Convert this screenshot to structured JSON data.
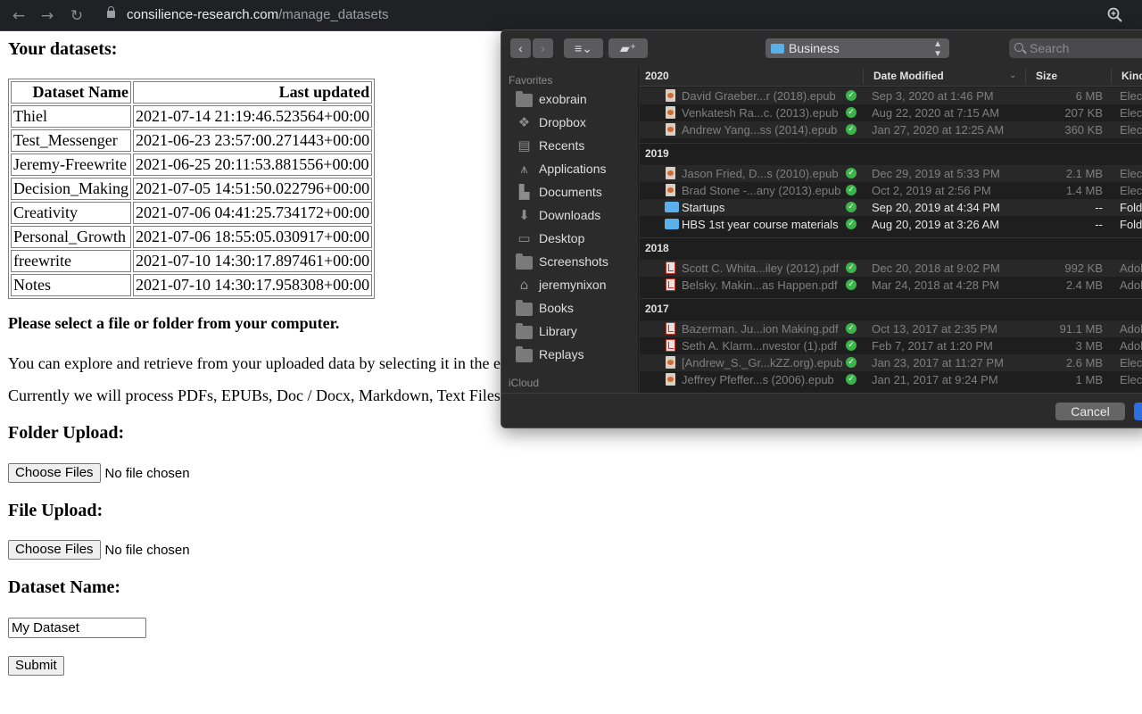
{
  "browser": {
    "url_host": "consilience-research.com",
    "url_path": "/manage_datasets",
    "icons": [
      "back-arrow-icon",
      "forward-arrow-icon",
      "reload-icon",
      "lock-icon",
      "zoom-icon"
    ]
  },
  "page": {
    "title": "Your datasets:",
    "table": {
      "headers": [
        "Dataset Name",
        "Last updated"
      ],
      "rows": [
        [
          "Thiel",
          "2021-07-14 21:19:46.523564+00:00"
        ],
        [
          "Test_Messenger",
          "2021-06-23 23:57:00.271443+00:00"
        ],
        [
          "Jeremy-Freewrite",
          "2021-06-25 20:11:53.881556+00:00"
        ],
        [
          "Decision_Making",
          "2021-07-05 14:51:50.022796+00:00"
        ],
        [
          "Creativity",
          "2021-07-06 04:41:25.734172+00:00"
        ],
        [
          "Personal_Growth",
          "2021-07-06 18:55:05.030917+00:00"
        ],
        [
          "freewrite",
          "2021-07-10 14:30:17.897461+00:00"
        ],
        [
          "Notes",
          "2021-07-10 14:30:17.958308+00:00"
        ]
      ]
    },
    "select_prompt": "Please select a file or folder from your computer.",
    "explore_text": "You can explore and retrieve from your uploaded data by selecting it in the ext",
    "formats_text": "Currently we will process PDFs, EPUBs, Doc / Docx, Markdown, Text Files, I",
    "folder_upload": {
      "heading": "Folder Upload:",
      "button": "Choose Files",
      "status": "No file chosen"
    },
    "file_upload": {
      "heading": "File Upload:",
      "button": "Choose Files",
      "status": "No file chosen"
    },
    "dataset_name": {
      "heading": "Dataset Name:",
      "value": "My Dataset"
    },
    "submit_label": "Submit"
  },
  "dialog": {
    "location": "Business",
    "search_placeholder": "Search",
    "sidebar": {
      "favorites_label": "Favorites",
      "items": [
        {
          "label": "exobrain",
          "icon": "folder-icon"
        },
        {
          "label": "Dropbox",
          "icon": "dropbox-icon"
        },
        {
          "label": "Recents",
          "icon": "recents-icon"
        },
        {
          "label": "Applications",
          "icon": "applications-icon"
        },
        {
          "label": "Documents",
          "icon": "documents-icon"
        },
        {
          "label": "Downloads",
          "icon": "downloads-icon"
        },
        {
          "label": "Desktop",
          "icon": "desktop-icon"
        },
        {
          "label": "Screenshots",
          "icon": "folder-icon"
        },
        {
          "label": "jeremynixon",
          "icon": "home-icon"
        },
        {
          "label": "Books",
          "icon": "folder-icon"
        },
        {
          "label": "Library",
          "icon": "folder-icon"
        },
        {
          "label": "Replays",
          "icon": "folder-icon"
        }
      ],
      "icloud_label": "iCloud"
    },
    "columns": {
      "name": "2020",
      "date": "Date Modified",
      "size": "Size",
      "kind": "Kind"
    },
    "groups": [
      {
        "label": "2020",
        "files": [
          {
            "name": "David Graeber...r (2018).epub",
            "date": "Sep 3, 2020 at 1:46 PM",
            "size": "6 MB",
            "kind": "Elect",
            "type": "epub"
          },
          {
            "name": "Venkatesh Ra...c. (2013).epub",
            "date": "Aug 22, 2020 at 7:15 AM",
            "size": "207 KB",
            "kind": "Elect",
            "type": "epub"
          },
          {
            "name": "Andrew Yang...ss (2014).epub",
            "date": "Jan 27, 2020 at 12:25 AM",
            "size": "360 KB",
            "kind": "Elect",
            "type": "epub"
          }
        ]
      },
      {
        "label": "2019",
        "files": [
          {
            "name": "Jason Fried, D...s (2010).epub",
            "date": "Dec 29, 2019 at 5:33 PM",
            "size": "2.1 MB",
            "kind": "Elect",
            "type": "epub"
          },
          {
            "name": "Brad Stone -...any (2013).epub",
            "date": "Oct 2, 2019 at 2:56 PM",
            "size": "1.4 MB",
            "kind": "Elect",
            "type": "epub"
          },
          {
            "name": "Startups",
            "date": "Sep 20, 2019 at 4:34 PM",
            "size": "--",
            "kind": "Folde",
            "type": "folder"
          },
          {
            "name": "HBS 1st year course materials",
            "date": "Aug 20, 2019 at 3:26 AM",
            "size": "--",
            "kind": "Folde",
            "type": "folder"
          }
        ]
      },
      {
        "label": "2018",
        "files": [
          {
            "name": "Scott C. Whita...iley (2012).pdf",
            "date": "Dec 20, 2018 at 9:02 PM",
            "size": "992 KB",
            "kind": "Adob",
            "type": "pdf"
          },
          {
            "name": "Belsky. Makin...as Happen.pdf",
            "date": "Mar 24, 2018 at 4:28 PM",
            "size": "2.4 MB",
            "kind": "Adob",
            "type": "pdf"
          }
        ]
      },
      {
        "label": "2017",
        "files": [
          {
            "name": "Bazerman. Ju...ion Making.pdf",
            "date": "Oct 13, 2017 at 2:35 PM",
            "size": "91.1 MB",
            "kind": "Adob",
            "type": "pdf"
          },
          {
            "name": "Seth A. Klarm...nvestor  (1).pdf",
            "date": "Feb 7, 2017 at 1:20 PM",
            "size": "3 MB",
            "kind": "Adob",
            "type": "pdf"
          },
          {
            "name": "[Andrew_S._Gr...kZZ.org).epub",
            "date": "Jan 23, 2017 at 11:27 PM",
            "size": "2.6 MB",
            "kind": "Elect",
            "type": "epub"
          },
          {
            "name": "Jeffrey Pfeffer...s (2006).epub",
            "date": "Jan 21, 2017 at 9:24 PM",
            "size": "1 MB",
            "kind": "Elect",
            "type": "epub"
          }
        ]
      }
    ],
    "cancel_label": "Cancel"
  }
}
